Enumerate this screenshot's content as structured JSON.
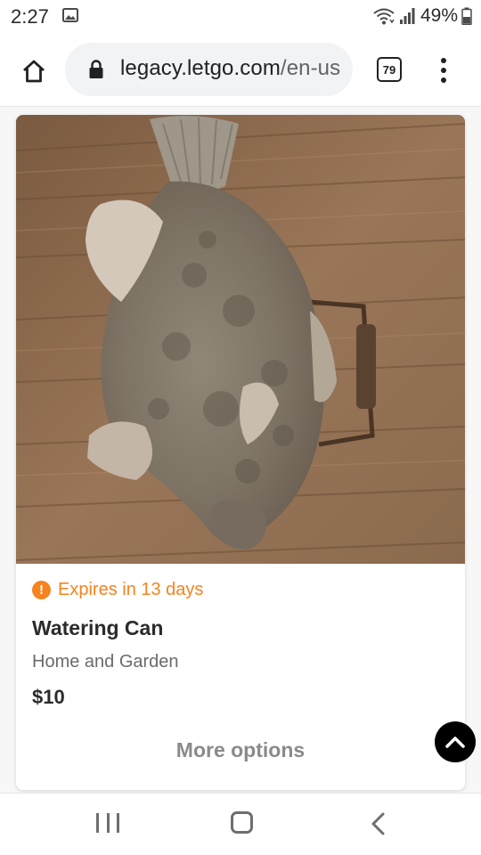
{
  "status_bar": {
    "time": "2:27",
    "battery_percent": "49%",
    "icons": [
      "image-notification-icon",
      "wifi-icon",
      "signal-icon",
      "battery-icon"
    ]
  },
  "browser": {
    "url_domain": "legacy.letgo.com",
    "url_path": "/en-us",
    "tab_count": "79",
    "icons": [
      "home-icon",
      "lock-icon",
      "tabs-icon",
      "overflow-menu-icon"
    ]
  },
  "listing": {
    "image_subject": "carved wooden fish",
    "expiry_text": "Expires in 13 days",
    "expiry_icon_glyph": "!",
    "title": "Watering Can",
    "category": "Home and Garden",
    "price": "$10",
    "more_options_label": "More options"
  },
  "colors": {
    "accent_orange": "#f5831f",
    "text_dark": "#2b2b2b",
    "text_muted": "#6b6b6b",
    "button_grey": "#8a8a8a"
  },
  "nav_bar": {
    "icons": [
      "recent-apps-icon",
      "home-nav-icon",
      "back-icon"
    ]
  }
}
